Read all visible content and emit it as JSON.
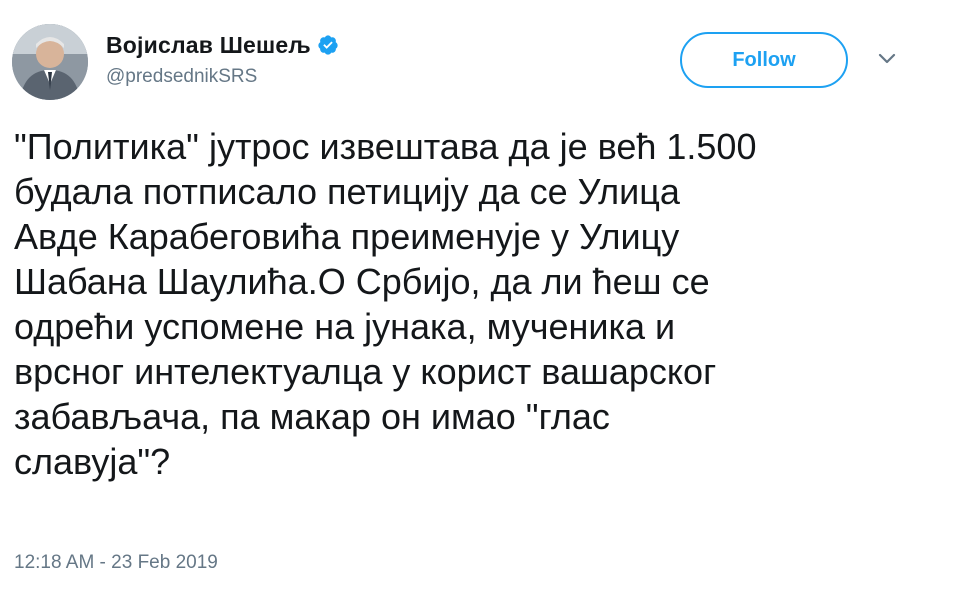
{
  "user": {
    "display_name": "Војислав Шешељ",
    "handle": "@predsednikSRS",
    "verified": true
  },
  "follow_button": {
    "label": "Follow"
  },
  "menu": {
    "icon": "chevron-down-icon"
  },
  "tweet": {
    "text": "\"Политика\" јутрос извештава да је већ 1.500\nбудала потписало петицију да се Улица\nАвде Карабеговића преименује у Улицу\nШабана Шаулића.О Србијо, да ли ћеш се\nодрећи успомене на јунака, мученика и\nврсног интелектуалца у корист вашарског\nзабављача, па макар он имао \"глас\nславуја\"?",
    "timestamp": "12:18 AM - 23 Feb 2019"
  },
  "colors": {
    "accent": "#1da1f2",
    "text": "#14171a",
    "muted": "#657786"
  }
}
